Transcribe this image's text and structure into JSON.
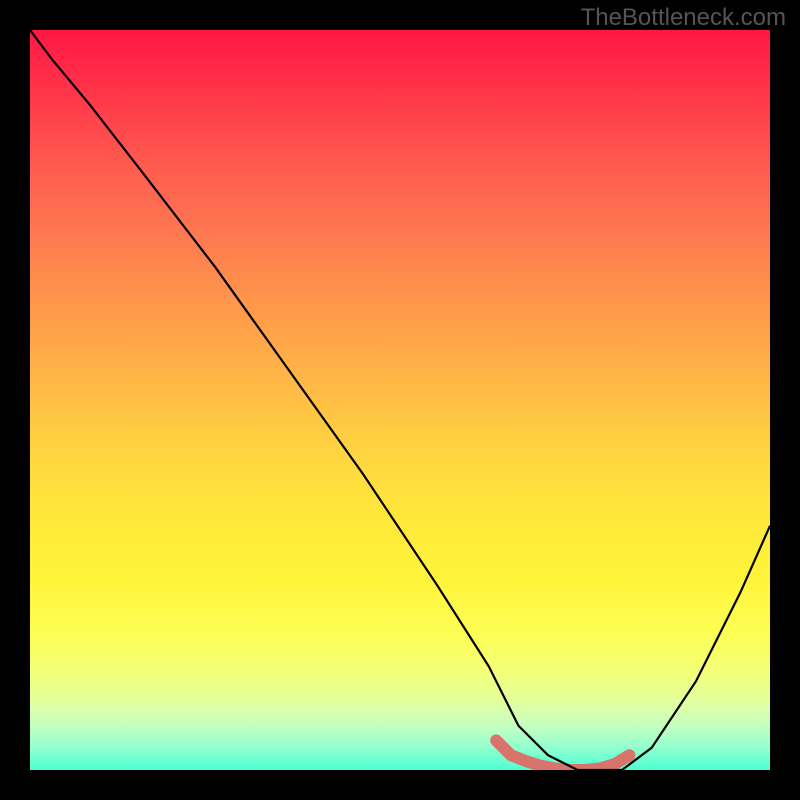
{
  "watermark": "TheBottleneck.com",
  "chart_data": {
    "type": "line",
    "title": "",
    "xlabel": "",
    "ylabel": "",
    "xlim": [
      0,
      100
    ],
    "ylim": [
      0,
      100
    ],
    "gradient_stops": [
      {
        "pos": 0,
        "color": "#ff1744"
      },
      {
        "pos": 10,
        "color": "#ff3b4a"
      },
      {
        "pos": 18,
        "color": "#ff5a4f"
      },
      {
        "pos": 28,
        "color": "#ff7a50"
      },
      {
        "pos": 38,
        "color": "#ff9a4a"
      },
      {
        "pos": 48,
        "color": "#ffb946"
      },
      {
        "pos": 58,
        "color": "#ffd740"
      },
      {
        "pos": 66,
        "color": "#ffe83a"
      },
      {
        "pos": 74,
        "color": "#fff33a"
      },
      {
        "pos": 82,
        "color": "#fdff56"
      },
      {
        "pos": 87,
        "color": "#f2ff7a"
      },
      {
        "pos": 91,
        "color": "#e0ffa0"
      },
      {
        "pos": 94,
        "color": "#c5ffc0"
      },
      {
        "pos": 97,
        "color": "#90ffce"
      },
      {
        "pos": 100,
        "color": "#4effd2"
      }
    ],
    "series": [
      {
        "name": "bottleneck-curve",
        "color": "#000000",
        "x": [
          0,
          3,
          8,
          15,
          25,
          35,
          45,
          55,
          62,
          66,
          70,
          74,
          77,
          80,
          84,
          90,
          96,
          100
        ],
        "values": [
          100,
          96,
          90,
          81,
          68,
          54,
          40,
          25,
          14,
          6,
          2,
          0,
          0,
          0,
          3,
          12,
          24,
          33
        ]
      }
    ],
    "highlight_segment": {
      "name": "flat-minimum",
      "color": "#d9746c",
      "width": 12,
      "x": [
        63,
        65,
        67,
        69,
        71,
        73,
        75,
        77,
        79,
        81
      ],
      "values": [
        4,
        2,
        1.2,
        0.6,
        0.2,
        0,
        0,
        0.2,
        0.8,
        2
      ]
    }
  }
}
